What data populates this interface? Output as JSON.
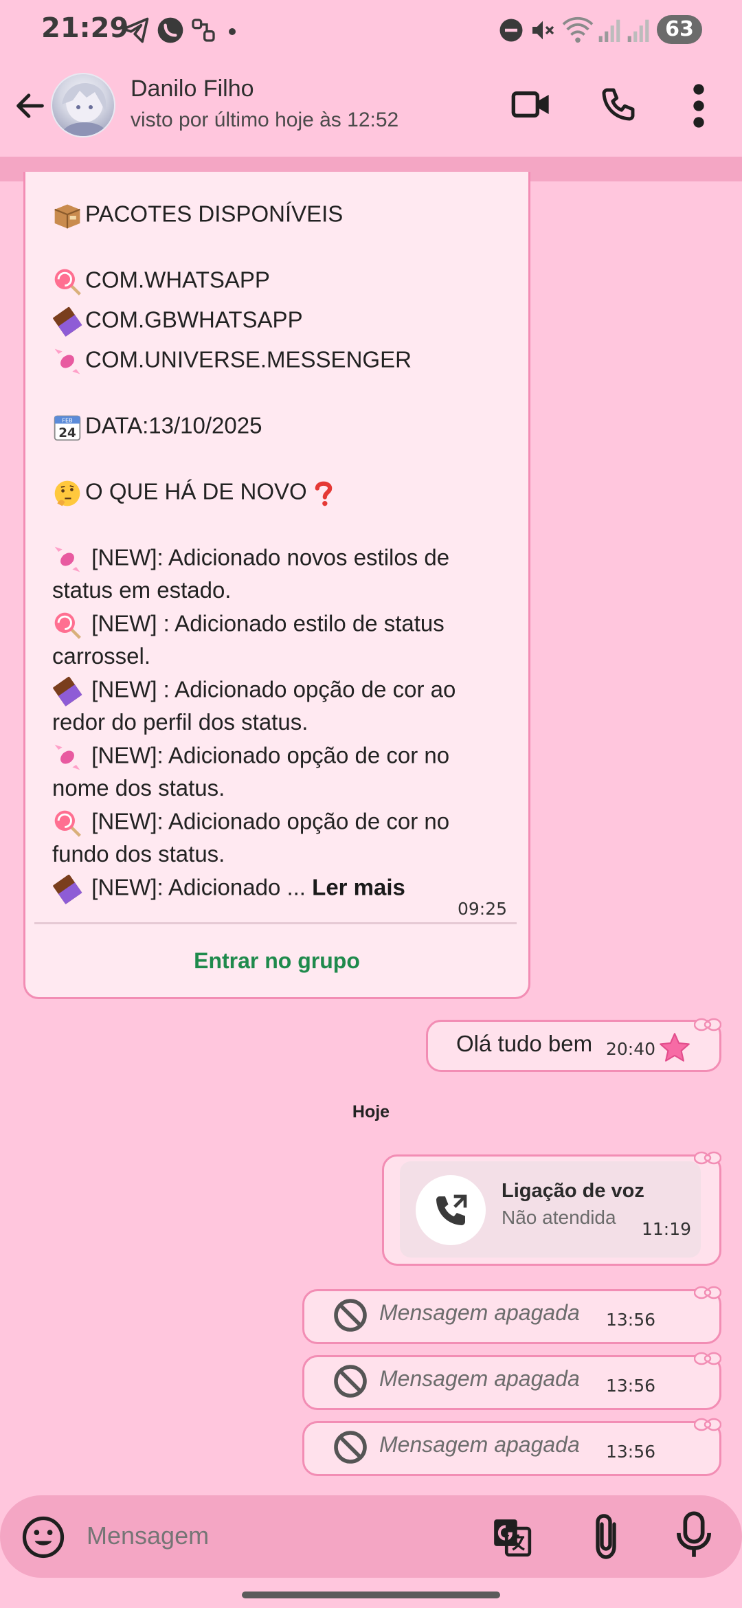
{
  "status_bar": {
    "time": "21:29",
    "battery": "63",
    "icons": [
      "telegram-icon",
      "whatsapp-icon",
      "link-icon",
      "dot-icon",
      "dnd-icon",
      "mute-icon",
      "wifi-icon",
      "signal-icon",
      "signal-icon"
    ]
  },
  "header": {
    "name": "Danilo Filho",
    "last_seen": "visto por último hoje às 12:52",
    "icons": [
      "back-arrow-icon",
      "video-call-icon",
      "phone-icon",
      "more-vert-icon"
    ]
  },
  "channel_message": {
    "lines": [
      {
        "emoji": "package",
        "text": "PACOTES DISPONÍVEIS"
      },
      {
        "emoji": "lollipop",
        "text": "COM.WHATSAPP"
      },
      {
        "emoji": "chocolate",
        "text": "COM.GBWHATSAPP"
      },
      {
        "emoji": "candy",
        "text": "COM.UNIVERSE.MESSENGER"
      },
      {
        "emoji": "calendar",
        "text": "DATA:13/10/2025"
      },
      {
        "emoji": "thinking",
        "text": "O QUE HÁ DE NOVO"
      },
      {
        "emoji": "candy",
        "text": " [NEW]: Adicionado novos estilos de"
      },
      {
        "emoji": "",
        "text": "status em estado."
      },
      {
        "emoji": "lollipop",
        "text": " [NEW] : Adicionado estilo de status"
      },
      {
        "emoji": "",
        "text": "carrossel."
      },
      {
        "emoji": "chocolate",
        "text": " [NEW] : Adicionado opção de cor ao"
      },
      {
        "emoji": "",
        "text": "redor do  perfil dos status."
      },
      {
        "emoji": "candy",
        "text": " [NEW]: Adicionado opção de cor no"
      },
      {
        "emoji": "",
        "text": "nome dos status."
      },
      {
        "emoji": "lollipop",
        "text": " [NEW]: Adicionado opção de cor no"
      },
      {
        "emoji": "",
        "text": "fundo dos status."
      },
      {
        "emoji": "chocolate",
        "text": " [NEW]: Adicionado ... "
      }
    ],
    "calendar_month": "FEB",
    "calendar_day": "24",
    "read_more": "Ler mais",
    "time": "09:25",
    "join_label": "Entrar no grupo"
  },
  "sent_message": {
    "text": "Olá tudo bem",
    "time": "20:40"
  },
  "date_chip": "Hoje",
  "call_message": {
    "title": "Ligação de voz",
    "subtitle": "Não atendida",
    "time": "11:19"
  },
  "deleted_messages": [
    {
      "text": "Mensagem apagada",
      "time": "13:56"
    },
    {
      "text": "Mensagem apagada",
      "time": "13:56"
    },
    {
      "text": "Mensagem apagada",
      "time": "13:56"
    }
  ],
  "composer": {
    "placeholder": "Mensagem"
  },
  "colors": {
    "background": "#ffc6dd",
    "accent": "#f4a6c4",
    "link": "#1f8a4c",
    "bubble_border": "#f28db4"
  }
}
